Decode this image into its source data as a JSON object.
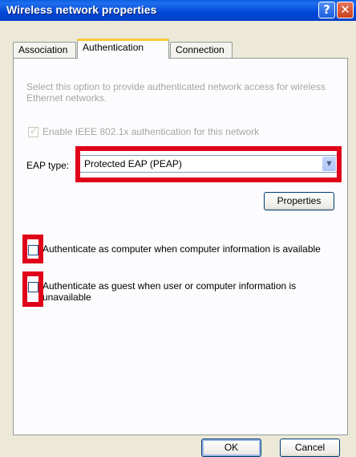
{
  "window": {
    "title": "Wireless network properties",
    "help_glyph": "?",
    "close_glyph": "✕"
  },
  "tabs": [
    {
      "label": "Association"
    },
    {
      "label": "Authentication"
    },
    {
      "label": "Connection"
    }
  ],
  "authentication": {
    "description": "Select this option to provide authenticated network access for wireless Ethernet networks.",
    "enable_8021x": {
      "label": "Enable IEEE 802.1x authentication for this network",
      "checked": true
    },
    "eap_type_label": "EAP type:",
    "eap_type_value": "Protected EAP (PEAP)",
    "properties_label": "Properties",
    "auth_computer": {
      "label": "Authenticate as computer when computer information is available",
      "checked": false
    },
    "auth_guest": {
      "label": "Authenticate as guest when user or computer information is unavailable",
      "checked": false
    }
  },
  "footer": {
    "ok_label": "OK",
    "cancel_label": "Cancel"
  },
  "colors": {
    "highlight": "#e0001a",
    "title_bar": "#0047d6",
    "active_tab_accent": "#ffc83c"
  },
  "icons": {
    "help": "help-icon",
    "close": "close-icon",
    "dropdown": "chevron-down-icon",
    "check": "checkmark-icon"
  }
}
